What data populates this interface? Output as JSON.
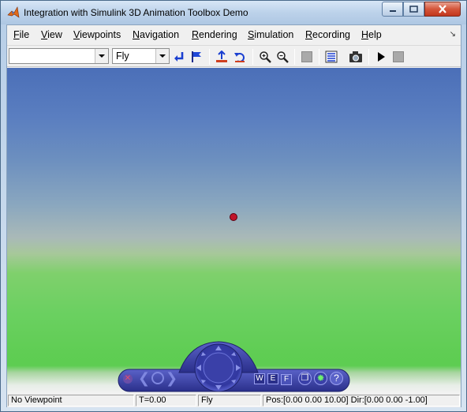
{
  "window": {
    "title": "Integration with Simulink 3D Animation Toolbox Demo"
  },
  "menu": {
    "items": [
      "File",
      "View",
      "Viewpoints",
      "Navigation",
      "Rendering",
      "Simulation",
      "Recording",
      "Help"
    ]
  },
  "toolbar": {
    "viewpoint_combo_value": "",
    "navigation_mode_value": "Fly"
  },
  "nav_panel": {
    "wireframe_label": "W",
    "edges_label": "E",
    "faces_label": "F",
    "help_label": "?"
  },
  "status": {
    "viewpoint": "No Viewpoint",
    "time": "T=0.00",
    "mode": "Fly",
    "position": "Pos:[0.00 0.00 10.00] Dir:[0.00 0.00 -1.00]"
  },
  "colors": {
    "sky_top": "#4b6fb8",
    "ground": "#5bcc4f",
    "target_marker": "#c0142a",
    "nav_panel": "#3a3fa0"
  }
}
